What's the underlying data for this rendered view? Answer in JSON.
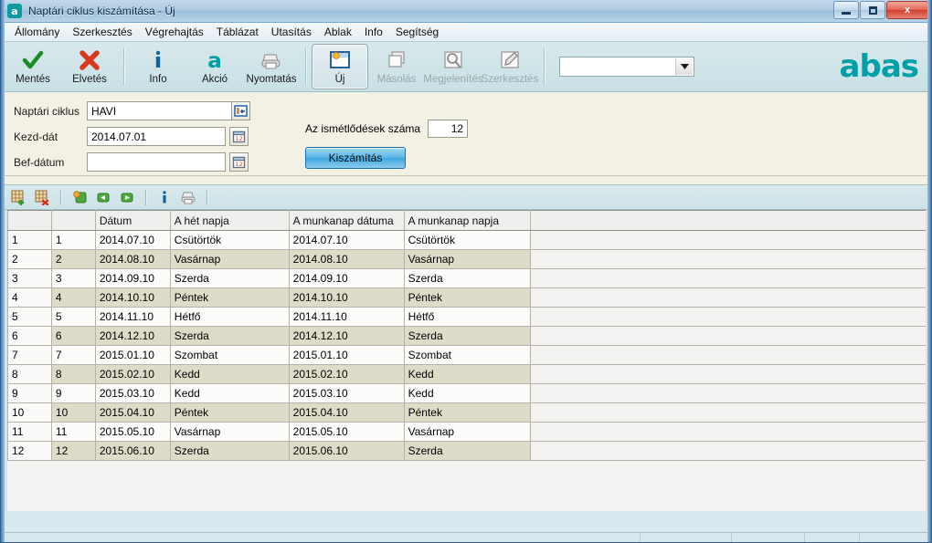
{
  "window": {
    "title": "Naptári ciklus kiszámítása - Új",
    "app_icon": "abas-icon",
    "minimize_label": "–",
    "maximize_label": "□",
    "close_label": "x"
  },
  "menubar": {
    "items": [
      {
        "label": "Állomány"
      },
      {
        "label": "Szerkesztés"
      },
      {
        "label": "Végrehajtás"
      },
      {
        "label": "Táblázat"
      },
      {
        "label": "Utasítás"
      },
      {
        "label": "Ablak"
      },
      {
        "label": "Info"
      },
      {
        "label": "Segítség"
      }
    ]
  },
  "toolbar": {
    "buttons": [
      {
        "label": "Mentés",
        "icon": "check-icon",
        "state": "enabled"
      },
      {
        "label": "Elvetés",
        "icon": "cross-icon",
        "state": "enabled"
      },
      {
        "label": "Info",
        "icon": "info-icon",
        "state": "enabled"
      },
      {
        "label": "Akció",
        "icon": "action-a-icon",
        "state": "enabled"
      },
      {
        "label": "Nyomtatás",
        "icon": "printer-icon",
        "state": "enabled"
      },
      {
        "label": "Új",
        "icon": "new-window-icon",
        "state": "active"
      },
      {
        "label": "Másolás",
        "icon": "copy-icon",
        "state": "disabled"
      },
      {
        "label": "Megjelenítés",
        "icon": "magnifier-icon",
        "state": "disabled"
      },
      {
        "label": "Szerkesztés",
        "icon": "pencil-icon",
        "state": "disabled"
      }
    ],
    "combo": {
      "value": "",
      "placeholder": "",
      "icon": "chevron-down-icon"
    },
    "brand": "abas",
    "brand_color": "#00a0a6"
  },
  "form": {
    "cycle": {
      "label": "Naptári ciklus",
      "value": "HAVI",
      "picker_icon": "select-record-icon"
    },
    "start_date": {
      "label": "Kezd-dát",
      "value": "2014.07.01",
      "picker_icon": "calendar-icon"
    },
    "end_date": {
      "label": "Bef-dátum",
      "value": "",
      "placeholder": "",
      "picker_icon": "calendar-icon"
    },
    "repetitions": {
      "label": "Az ismétlődések száma",
      "value": "12"
    },
    "calculate_button": "Kiszámítás"
  },
  "table_toolbar": {
    "buttons": [
      {
        "icon": "insert-row-icon",
        "name": "insert-row"
      },
      {
        "icon": "delete-row-icon",
        "name": "delete-row"
      },
      {
        "icon": "select-row-icon",
        "name": "select-row"
      },
      {
        "icon": "prev-page-icon",
        "name": "previous"
      },
      {
        "icon": "next-page-icon",
        "name": "next"
      },
      {
        "icon": "info-icon",
        "name": "row-info"
      },
      {
        "icon": "printer-icon",
        "name": "print-table"
      }
    ]
  },
  "table": {
    "columns": [
      {
        "key": "rownum",
        "label": ""
      },
      {
        "key": "index",
        "label": ""
      },
      {
        "key": "date",
        "label": "Dátum"
      },
      {
        "key": "weekday",
        "label": "A hét napja"
      },
      {
        "key": "workdate",
        "label": "A munkanap dátuma"
      },
      {
        "key": "workday",
        "label": "A munkanap napja"
      },
      {
        "key": "pad",
        "label": ""
      }
    ],
    "rows": [
      {
        "rownum": "1",
        "index": "1",
        "date": "2014.07.10",
        "weekday": "Csütörtök",
        "workdate": "2014.07.10",
        "workday": "Csütörtök"
      },
      {
        "rownum": "2",
        "index": "2",
        "date": "2014.08.10",
        "weekday": "Vasárnap",
        "workdate": "2014.08.10",
        "workday": "Vasárnap"
      },
      {
        "rownum": "3",
        "index": "3",
        "date": "2014.09.10",
        "weekday": "Szerda",
        "workdate": "2014.09.10",
        "workday": "Szerda"
      },
      {
        "rownum": "4",
        "index": "4",
        "date": "2014.10.10",
        "weekday": "Péntek",
        "workdate": "2014.10.10",
        "workday": "Péntek"
      },
      {
        "rownum": "5",
        "index": "5",
        "date": "2014.11.10",
        "weekday": "Hétfő",
        "workdate": "2014.11.10",
        "workday": "Hétfő"
      },
      {
        "rownum": "6",
        "index": "6",
        "date": "2014.12.10",
        "weekday": "Szerda",
        "workdate": "2014.12.10",
        "workday": "Szerda"
      },
      {
        "rownum": "7",
        "index": "7",
        "date": "2015.01.10",
        "weekday": "Szombat",
        "workdate": "2015.01.10",
        "workday": "Szombat"
      },
      {
        "rownum": "8",
        "index": "8",
        "date": "2015.02.10",
        "weekday": "Kedd",
        "workdate": "2015.02.10",
        "workday": "Kedd"
      },
      {
        "rownum": "9",
        "index": "9",
        "date": "2015.03.10",
        "weekday": "Kedd",
        "workdate": "2015.03.10",
        "workday": "Kedd"
      },
      {
        "rownum": "10",
        "index": "10",
        "date": "2015.04.10",
        "weekday": "Péntek",
        "workdate": "2015.04.10",
        "workday": "Péntek"
      },
      {
        "rownum": "11",
        "index": "11",
        "date": "2015.05.10",
        "weekday": "Vasárnap",
        "workdate": "2015.05.10",
        "workday": "Vasárnap"
      },
      {
        "rownum": "12",
        "index": "12",
        "date": "2015.06.10",
        "weekday": "Szerda",
        "workdate": "2015.06.10",
        "workday": "Szerda"
      }
    ]
  }
}
